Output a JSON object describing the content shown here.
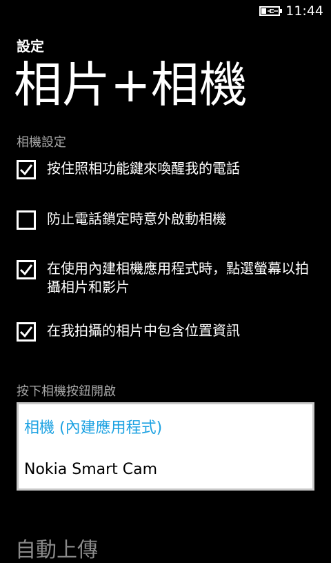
{
  "status_bar": {
    "time": "11:44",
    "battery_icon": "battery-charging-icon"
  },
  "header": {
    "app_title": "設定",
    "page_title": "相片+相機"
  },
  "camera_settings": {
    "section_label": "相機設定",
    "options": [
      {
        "label": "按住照相功能鍵來喚醒我的電話",
        "checked": true
      },
      {
        "label": "防止電話鎖定時意外啟動相機",
        "checked": false
      },
      {
        "label": "在使用內建相機應用程式時，點選螢幕以拍攝相片和影片",
        "checked": true
      },
      {
        "label": "在我拍攝的相片中包含位置資訊",
        "checked": true
      }
    ]
  },
  "camera_button": {
    "section_label": "按下相機按鈕開啟",
    "options": [
      {
        "label": "相機 (內建應用程式)",
        "selected": true
      },
      {
        "label": "Nokia Smart Cam",
        "selected": false
      }
    ]
  },
  "next_section": {
    "label": "自動上傳"
  },
  "colors": {
    "accent": "#1ba1e2",
    "background": "#000000",
    "subtle_text": "#a6a6a6"
  }
}
